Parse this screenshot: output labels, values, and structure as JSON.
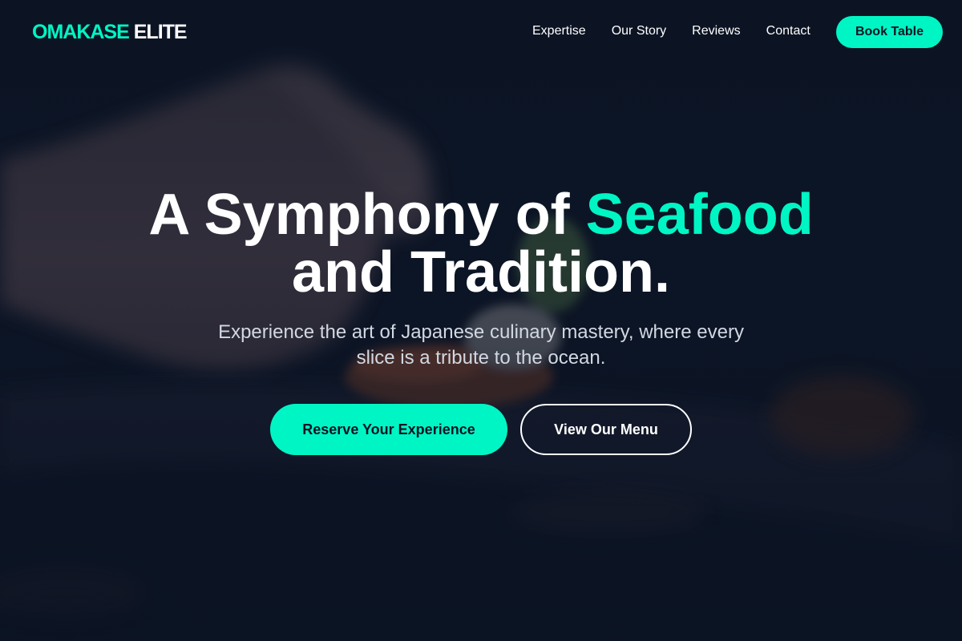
{
  "brand": {
    "name_part1": "OMAKASE",
    "name_part2": "ELITE"
  },
  "nav": {
    "links": [
      {
        "label": "Expertise"
      },
      {
        "label": "Our Story"
      },
      {
        "label": "Reviews"
      },
      {
        "label": "Contact"
      }
    ],
    "cta_label": "Book Table"
  },
  "hero": {
    "headline_pre": "A Symphony of ",
    "headline_accent": "Seafood",
    "headline_post": "and Tradition.",
    "subheadline": "Experience the art of Japanese culinary mastery, where every slice is a tribute to the ocean.",
    "primary_button": "Reserve Your Experience",
    "secondary_button": "View Our Menu",
    "background_image": "chef-hand-plating-sushi-photo"
  },
  "colors": {
    "accent": "#00f5c4",
    "background": "#0b1322",
    "text": "#ffffff"
  }
}
